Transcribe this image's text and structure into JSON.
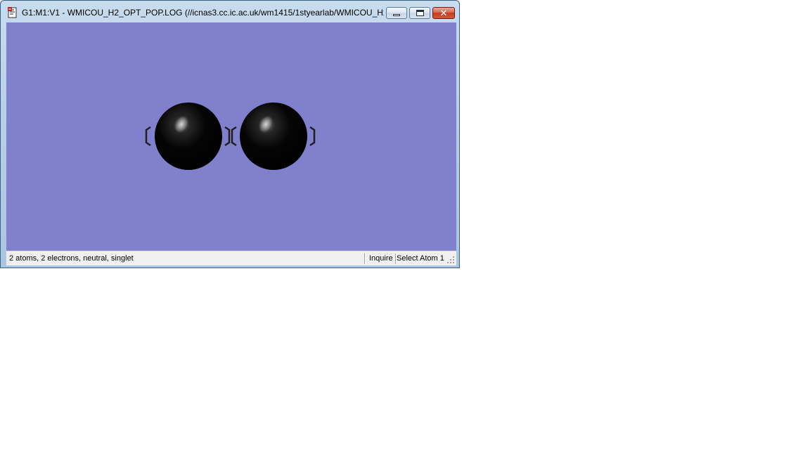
{
  "window": {
    "title": "G1:M1:V1 - WMICOU_H2_OPT_POP.LOG (//icnas3.cc.ic.ac.uk/wm1415/1styearlab/WMICOU_H2...",
    "app_icon": "gaussview-doc-icon",
    "buttons": {
      "minimize": "minimize-icon",
      "maximize": "maximize-icon",
      "close": "close-icon"
    }
  },
  "viewer": {
    "background_color": "#8080CC",
    "molecule": {
      "atoms": [
        {
          "element": "H",
          "color": "#000000",
          "label": ""
        },
        {
          "element": "H",
          "color": "#000000",
          "label": ""
        }
      ]
    }
  },
  "status_bar": {
    "summary": "2 atoms, 2 electrons, neutral, singlet",
    "mode": "Inquire",
    "selection": "Select Atom 1"
  }
}
